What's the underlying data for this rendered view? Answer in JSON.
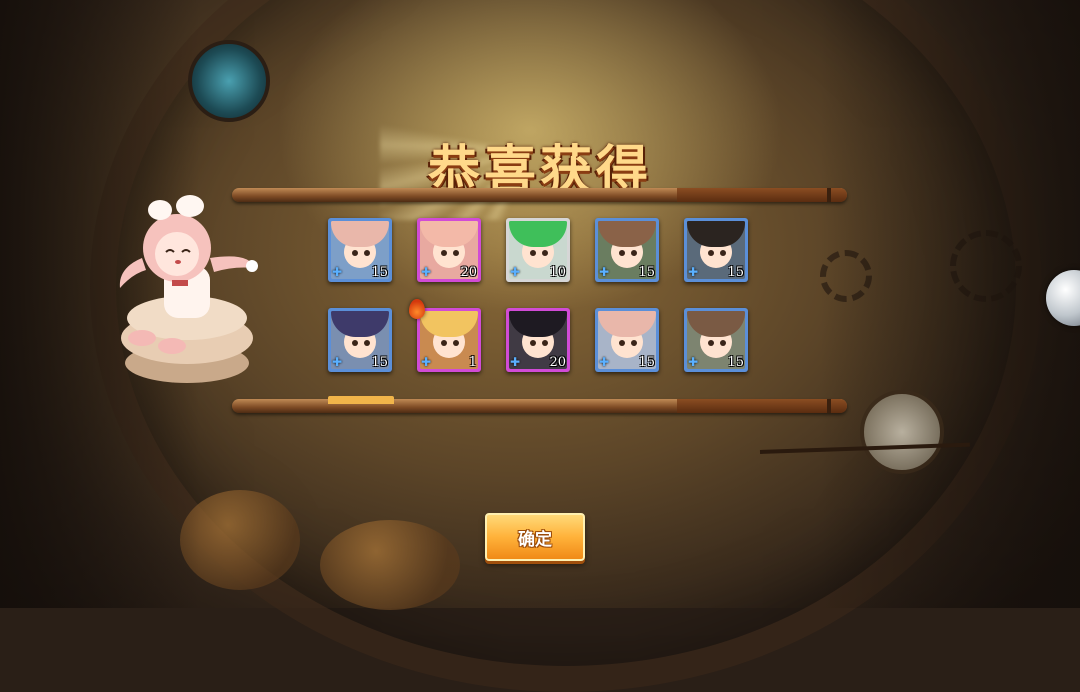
{
  "title": "恭喜获得",
  "confirm_label": "确定",
  "rewards": [
    {
      "count": "15",
      "frame": "#5b8fd8",
      "hair": "#e9b7aa",
      "bg": "#7d9fc8"
    },
    {
      "count": "20",
      "frame": "#d14bd6",
      "hair": "#f3b9a8",
      "bg": "#e8a9a0"
    },
    {
      "count": "10",
      "frame": "#d6d6d6",
      "hair": "#3fbf5a",
      "bg": "#c9d8cf"
    },
    {
      "count": "15",
      "frame": "#5b8fd8",
      "hair": "#8a6248",
      "bg": "#6a7d60"
    },
    {
      "count": "15",
      "frame": "#5b8fd8",
      "hair": "#2b2420",
      "bg": "#5a6a7a"
    },
    {
      "count": "15",
      "frame": "#5b8fd8",
      "hair": "#3e3a6a",
      "bg": "#7a8fb0"
    },
    {
      "count": "1",
      "frame": "#d14bd6",
      "hair": "#f2c460",
      "bg": "#c98a50"
    },
    {
      "count": "20",
      "frame": "#d14bd6",
      "hair": "#1e1a22",
      "bg": "#403a44"
    },
    {
      "count": "15",
      "frame": "#5b8fd8",
      "hair": "#e9b7aa",
      "bg": "#a8b4c8"
    },
    {
      "count": "15",
      "frame": "#5b8fd8",
      "hair": "#7a5a44",
      "bg": "#7d8470"
    }
  ],
  "colors": {
    "title": "#ffd98a",
    "button": "#ffb23a",
    "frame_rare": "#5b8fd8",
    "frame_epic": "#d14bd6",
    "frame_common": "#d6d6d6"
  }
}
